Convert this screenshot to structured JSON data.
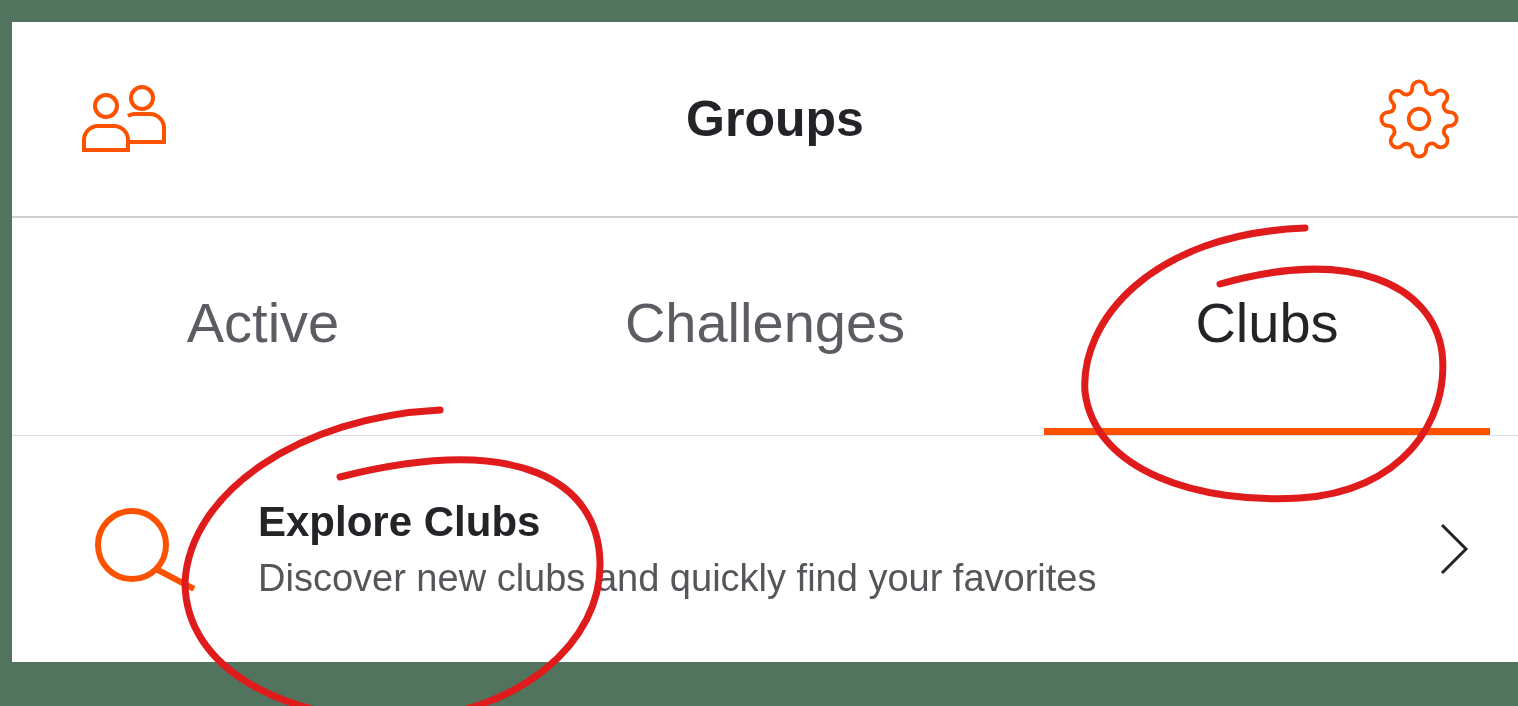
{
  "header": {
    "title": "Groups"
  },
  "tabs": [
    {
      "label": "Active",
      "selected": false
    },
    {
      "label": "Challenges",
      "selected": false
    },
    {
      "label": "Clubs",
      "selected": true
    }
  ],
  "explore_row": {
    "title": "Explore Clubs",
    "subtitle": "Discover new clubs and quickly find your favorites"
  },
  "annotations": [
    {
      "kind": "circle"
    },
    {
      "kind": "circle"
    }
  ]
}
